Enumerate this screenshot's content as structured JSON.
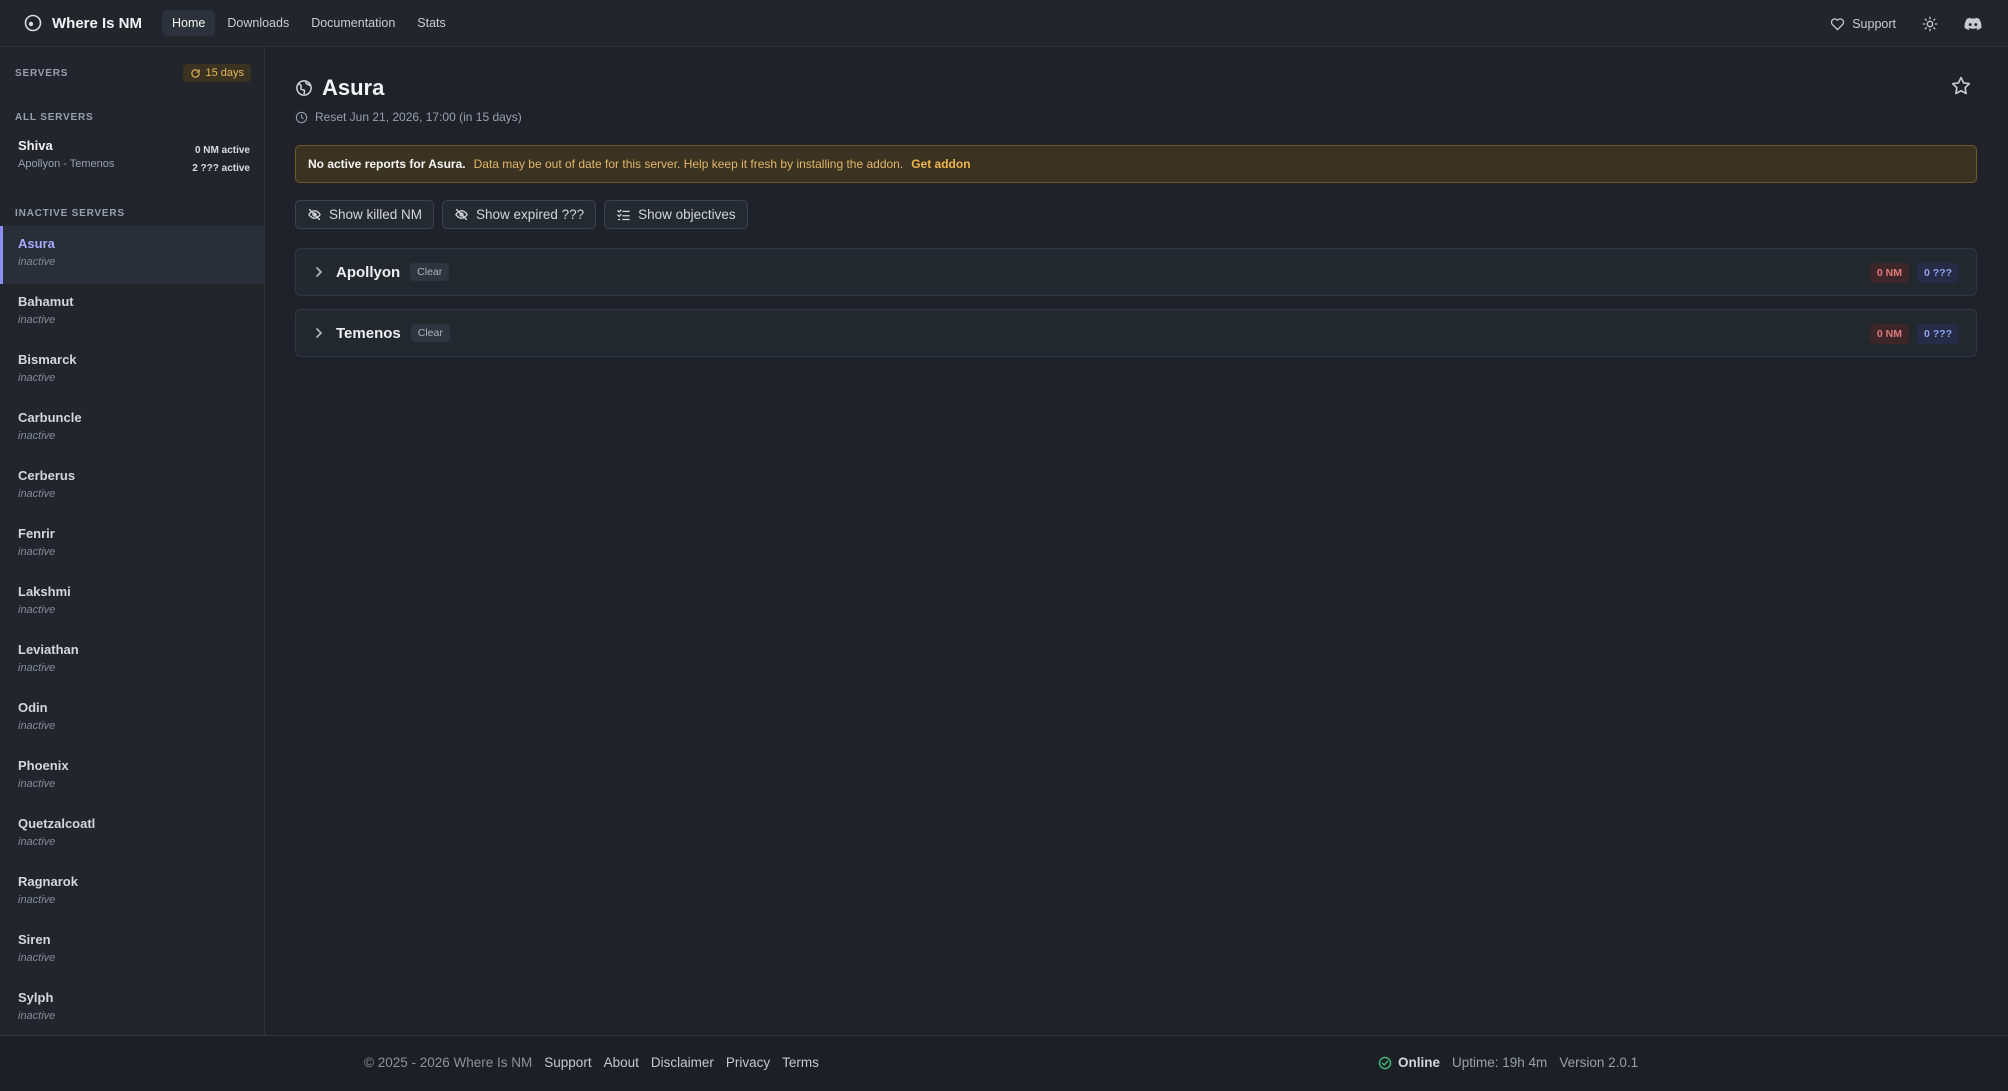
{
  "app": {
    "brand": "Where Is NM",
    "nav": [
      "Home",
      "Downloads",
      "Documentation",
      "Stats"
    ],
    "support_label": "Support"
  },
  "sidebar": {
    "servers_label": "SERVERS",
    "days_badge": "15 days",
    "all_servers_label": "ALL SERVERS",
    "all_server": {
      "name": "Shiva",
      "sub": "Apollyon - Temenos",
      "nm_active": "0 NM active",
      "q_active": "2 ??? active"
    },
    "inactive_label": "INACTIVE SERVERS",
    "servers": [
      {
        "name": "Asura",
        "status": "inactive"
      },
      {
        "name": "Bahamut",
        "status": "inactive"
      },
      {
        "name": "Bismarck",
        "status": "inactive"
      },
      {
        "name": "Carbuncle",
        "status": "inactive"
      },
      {
        "name": "Cerberus",
        "status": "inactive"
      },
      {
        "name": "Fenrir",
        "status": "inactive"
      },
      {
        "name": "Lakshmi",
        "status": "inactive"
      },
      {
        "name": "Leviathan",
        "status": "inactive"
      },
      {
        "name": "Odin",
        "status": "inactive"
      },
      {
        "name": "Phoenix",
        "status": "inactive"
      },
      {
        "name": "Quetzalcoatl",
        "status": "inactive"
      },
      {
        "name": "Ragnarok",
        "status": "inactive"
      },
      {
        "name": "Siren",
        "status": "inactive"
      },
      {
        "name": "Sylph",
        "status": "inactive"
      }
    ]
  },
  "main": {
    "title": "Asura",
    "reset": "Reset Jun 21, 2026, 17:00 (in 15 days)",
    "alert": {
      "strong": "No active reports for Asura.",
      "message": "Data may be out of date for this server. Help keep it fresh by installing the addon.",
      "link": "Get addon"
    },
    "toggles": [
      "Show killed NM",
      "Show expired ???",
      "Show objectives"
    ],
    "groups": [
      {
        "name": "Apollyon",
        "status": "Clear",
        "nm": "0 NM",
        "q": "0 ???"
      },
      {
        "name": "Temenos",
        "status": "Clear",
        "nm": "0 NM",
        "q": "0 ???"
      }
    ]
  },
  "footer": {
    "copyright": "© 2025 - 2026 Where Is NM",
    "links": [
      "Support",
      "About",
      "Disclaimer",
      "Privacy",
      "Terms"
    ],
    "status": "Online",
    "uptime": "Uptime: 19h 4m",
    "version": "Version 2.0.1"
  },
  "colors": {
    "accent": "#8b8ef2",
    "warning": "#e8b659",
    "nm_badge": "#e07a7a",
    "q_badge": "#8ea2f0",
    "online": "#3fb97a"
  }
}
